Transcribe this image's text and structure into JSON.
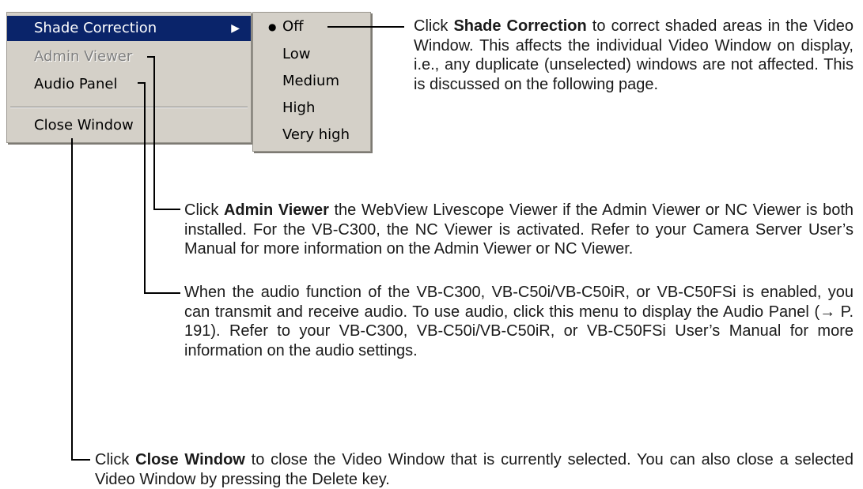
{
  "menu": {
    "items": [
      {
        "label": "Shade Correction",
        "state": "selected",
        "has_submenu": true
      },
      {
        "label": "Admin Viewer",
        "state": "disabled"
      },
      {
        "label": "Audio Panel",
        "state": "normal"
      },
      {
        "label": "Close Window",
        "state": "normal"
      }
    ]
  },
  "submenu": {
    "items": [
      {
        "label": "Off",
        "checked": true
      },
      {
        "label": "Low"
      },
      {
        "label": "Medium"
      },
      {
        "label": "High"
      },
      {
        "label": "Very high"
      }
    ]
  },
  "descriptions": {
    "shade": {
      "pre": "Click ",
      "term": "Shade Correction",
      "post": " to correct shaded areas in the Video Window. This affects the individual Video Window on display, i.e., any duplicate (unselected) windows are not affected. This is discussed on the following page."
    },
    "admin": {
      "pre": "Click ",
      "term": "Admin Viewer",
      "post": " the WebView Livescope Viewer if the Admin Viewer or NC Viewer is both installed. For the VB-C300, the NC Viewer is activated. Refer to your Camera Server User’s Manual for more information on the Admin Viewer or NC Viewer."
    },
    "audio": {
      "text": "When the audio function of the VB-C300, VB-C50i/VB-C50iR, or VB-C50FSi is enabled, you can transmit and receive audio. To use audio, click this menu to display the Audio Panel (→ P. 191). Refer to your VB-C300, VB-C50i/VB-C50iR, or VB-C50FSi User’s Manual for more information on the audio settings."
    },
    "close": {
      "pre": "Click ",
      "term": "Close Window",
      "post": " to close the Video Window that is currently selected. You can also close a selected Video Window by pressing the Delete key."
    }
  }
}
